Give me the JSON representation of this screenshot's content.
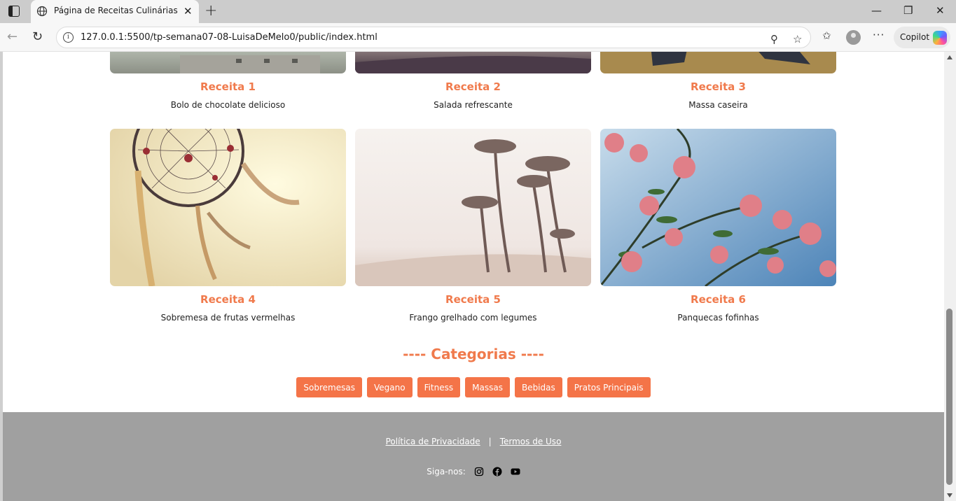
{
  "browser": {
    "tab_title": "Página de Receitas Culinárias",
    "url": "127.0.0.1:5500/tp-semana07-08-LuisaDeMelo0/public/index.html",
    "copilot_label": "Copilot"
  },
  "recipes": [
    {
      "title": "Receita 1",
      "description": "Bolo de chocolate delicioso"
    },
    {
      "title": "Receita 2",
      "description": "Salada refrescante"
    },
    {
      "title": "Receita 3",
      "description": "Massa caseira"
    },
    {
      "title": "Receita 4",
      "description": "Sobremesa de frutas vermelhas"
    },
    {
      "title": "Receita 5",
      "description": "Frango grelhado com legumes"
    },
    {
      "title": "Receita 6",
      "description": "Panquecas fofinhas"
    }
  ],
  "categories": {
    "title": "---- Categorias ----",
    "items": [
      "Sobremesas",
      "Vegano",
      "Fitness",
      "Massas",
      "Bebidas",
      "Pratos Principais"
    ]
  },
  "footer": {
    "privacy_link": "Política de Privacidade",
    "separator": "|",
    "terms_link": "Termos de Uso",
    "follow_label": "Siga-nos:",
    "social_icons": [
      "instagram-icon",
      "facebook-icon",
      "youtube-icon"
    ]
  },
  "colors": {
    "accent": "#f07a4c",
    "button": "#f47448",
    "footer_bg": "#a0a0a0"
  }
}
